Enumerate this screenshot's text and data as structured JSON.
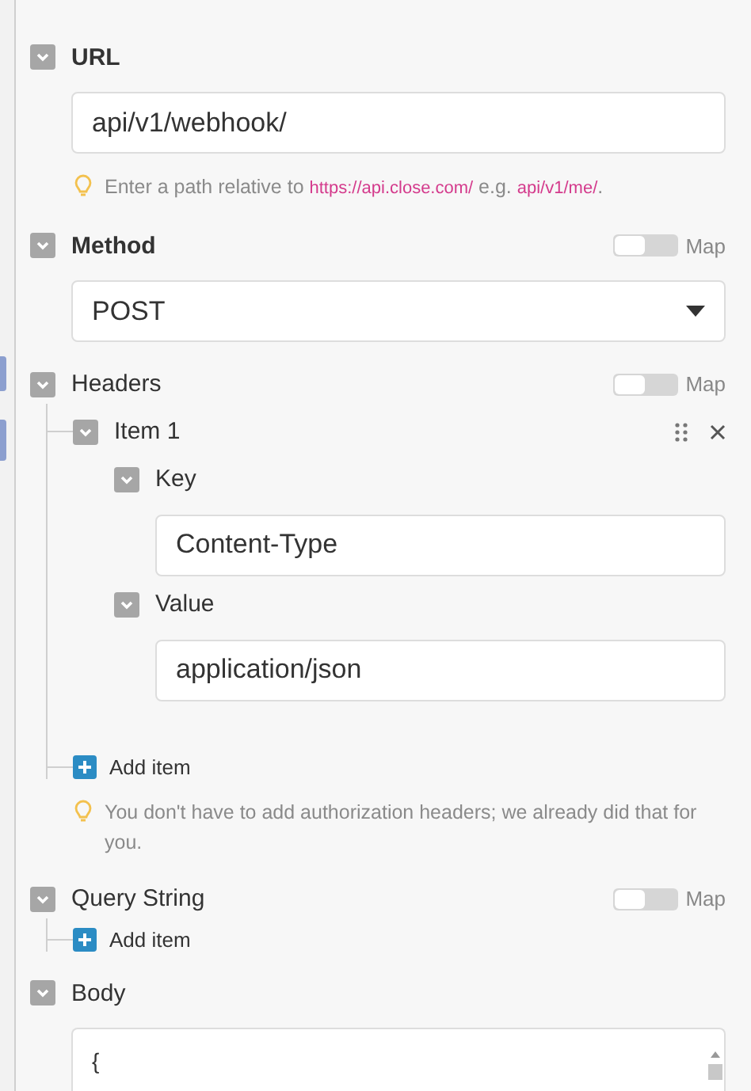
{
  "fields": [
    {
      "kind": "input",
      "label": "URL",
      "required": true,
      "expanded": true,
      "value": "api/v1/webhook/",
      "hint": [
        {
          "kind": "plain",
          "text": "Enter a path relative to "
        },
        {
          "kind": "link",
          "text": "https://api.close.com/"
        },
        {
          "kind": "plain",
          "text": " e.g. "
        },
        {
          "kind": "link",
          "text": "api/v1/me/"
        },
        {
          "kind": "plain",
          "text": "."
        }
      ]
    },
    {
      "kind": "select",
      "label": "Method",
      "required": true,
      "expanded": true,
      "map": {
        "label": "Map",
        "on": false
      },
      "value": "POST"
    },
    {
      "kind": "list",
      "label": "Headers",
      "required": false,
      "expanded": true,
      "map": {
        "label": "Map",
        "on": false
      },
      "items": [
        {
          "label": "Item 1",
          "expanded": true,
          "children": [
            {
              "label": "Key",
              "expanded": true,
              "value": "Content-Type"
            },
            {
              "label": "Value",
              "expanded": true,
              "value": "application/json"
            }
          ]
        }
      ],
      "add": "Add item",
      "hint": [
        {
          "kind": "plain",
          "text": "You don't have to add authorization headers; we already did that for you."
        }
      ]
    },
    {
      "kind": "list",
      "label": "Query String",
      "required": false,
      "expanded": true,
      "map": {
        "label": "Map",
        "on": false
      },
      "add": "Add item"
    },
    {
      "kind": "textarea",
      "label": "Body",
      "required": false,
      "expanded": true,
      "value": "{"
    }
  ]
}
